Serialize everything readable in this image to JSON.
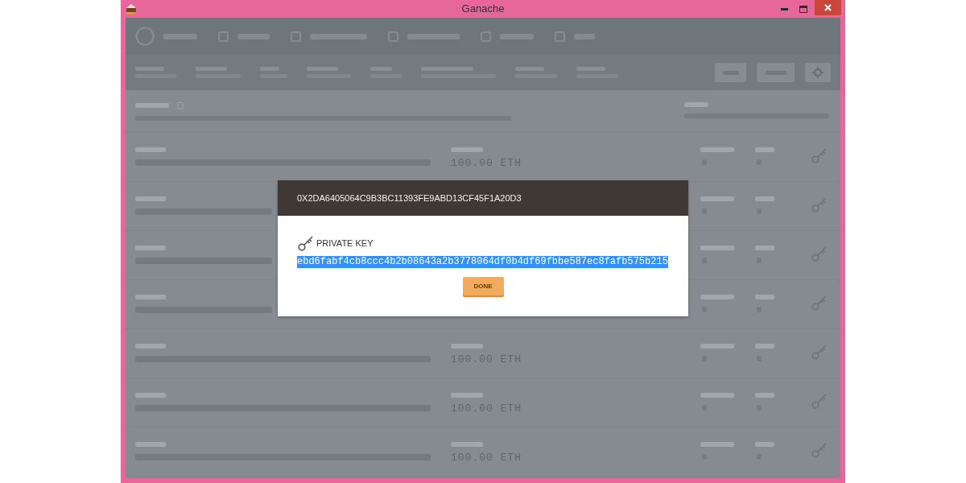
{
  "window": {
    "title": "Ganache"
  },
  "accounts": [
    {
      "kind": "full",
      "balance": "100.00 ETH"
    },
    {
      "kind": "under_dialog"
    },
    {
      "kind": "under_dialog"
    },
    {
      "kind": "under_dialog"
    },
    {
      "kind": "full",
      "balance": "100.00 ETH"
    },
    {
      "kind": "full",
      "balance": "100.00 ETH"
    },
    {
      "kind": "full",
      "balance": "100.00 ETH"
    }
  ],
  "modal": {
    "title": "0X2DA6405064C9B3BC11393FE9ABD13CF45F1A20D3",
    "label": "PRIVATE KEY",
    "private_key": {
      "value": "ebd6fabf4cb8ccc4b2b08643a2b3778064df0b4df69fbbe587ec8fafb575b215",
      "selected": true
    },
    "button": "DONE"
  }
}
